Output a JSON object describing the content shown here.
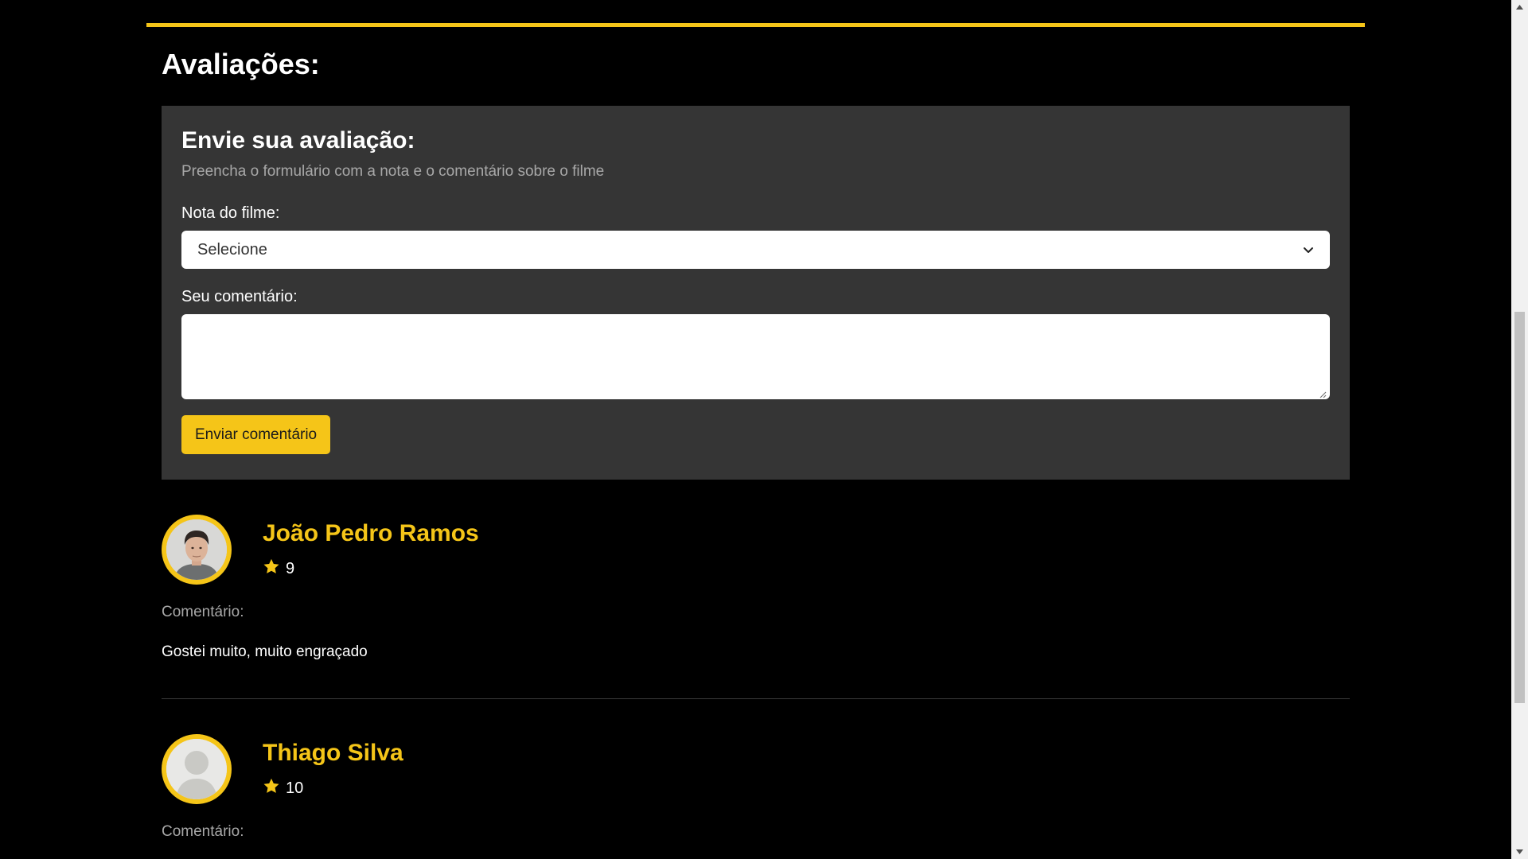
{
  "reviews_section": {
    "title": "Avaliações:"
  },
  "review_form": {
    "title": "Envie sua avaliação:",
    "subtitle": "Preencha o formulário com a nota e o comentário sobre o filme",
    "rating_label": "Nota do filme:",
    "rating_select_value": "Selecione",
    "comment_label": "Seu comentário:",
    "comment_value": "",
    "submit_label": "Enviar comentário"
  },
  "reviews": [
    {
      "name": "João Pedro Ramos",
      "rating": "9",
      "comment_label": "Comentário:",
      "comment": "Gostei muito, muito engraçado",
      "avatar": "user-photo"
    },
    {
      "name": "Thiago Silva",
      "rating": "10",
      "comment_label": "Comentário:",
      "comment": "",
      "avatar": "default-user-icon"
    }
  ],
  "colors": {
    "accent": "#f5c518",
    "card_bg": "#353535",
    "page_bg": "#000000",
    "muted_text": "#a8a8a8"
  },
  "icons": {
    "star": "star-icon",
    "select_chevron": "chevron-down-icon",
    "scroll_up": "arrow-up-icon",
    "scroll_down": "arrow-down-icon"
  }
}
